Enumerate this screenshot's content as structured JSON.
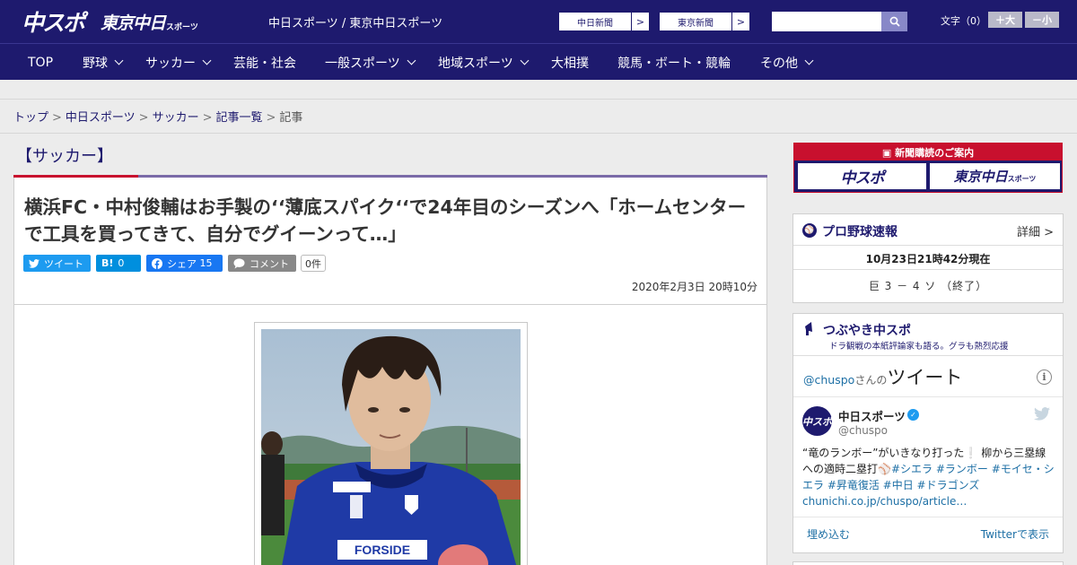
{
  "header": {
    "logo_chuspo": "中スポ",
    "logo_tokyo": "東京中日",
    "logo_tokyo_suffix": "スポーツ",
    "site_title": "中日スポーツ / 東京中日スポーツ",
    "paper_links": [
      {
        "label": "中日新聞"
      },
      {
        "label": "東京新聞"
      }
    ],
    "search": {
      "value": "",
      "placeholder": ""
    },
    "fontsize_label": "文字（0）",
    "fontsize_plus": "＋大",
    "fontsize_minus": "－小"
  },
  "nav": {
    "items": [
      {
        "label": "TOP",
        "dropdown": false
      },
      {
        "label": "野球",
        "dropdown": true
      },
      {
        "label": "サッカー",
        "dropdown": true
      },
      {
        "label": "芸能・社会",
        "dropdown": false
      },
      {
        "label": "一般スポーツ",
        "dropdown": true
      },
      {
        "label": "地域スポーツ",
        "dropdown": true
      },
      {
        "label": "大相撲",
        "dropdown": false
      },
      {
        "label": "競馬・ボート・競輪",
        "dropdown": false
      },
      {
        "label": "その他",
        "dropdown": true
      }
    ]
  },
  "breadcrumb": {
    "items": [
      "トップ",
      "中日スポーツ",
      "サッカー",
      "記事一覧"
    ],
    "current": "記事",
    "separator": ">"
  },
  "article": {
    "category": "【サッカー】",
    "headline": "横浜FC・中村俊輔はお手製の‘‘薄底スパイク‘‘で24年目のシーズンへ「ホームセンターで工具を買ってきて、自分でグイーンって…」",
    "share": {
      "tweet_label": "ツイート",
      "hatena_icon": "B!",
      "hatena_count": "0",
      "facebook_label": "シェア",
      "facebook_count": "15",
      "comment_label": "コメント",
      "comment_count": "0件"
    },
    "published": "2020年2月3日 20時10分",
    "photo_alt_icon": "player-photo"
  },
  "sidebar": {
    "subscribe": {
      "title": "新聞購読のご案内",
      "logo1": "中スポ",
      "logo2": "東京中日",
      "logo2_suffix": "スポーツ"
    },
    "baseball": {
      "title": "プロ野球速報",
      "more": "詳細 >",
      "time": "10月23日21時42分現在",
      "score": "巨 3 － 4 ソ （終了）"
    },
    "tsubuyaki": {
      "title": "つぶやき中スポ",
      "subtitle": "ドラ観戦の本紙評論家も語る。グラも熱烈応援",
      "handle_prefix": "@chuspo",
      "handle_suffix": "さんの",
      "tweets_label": "ツイート",
      "account_name": "中日スポーツ",
      "account_handle": "@chuspo",
      "avatar_text": "中スポ",
      "tweet_text_plain": "“竜のランボー”がいきなり打った❕ 柳から三塁線への適時二塁打",
      "tweet_tags": "#シエラ #ランボー #モイセ・シエラ #昇竜復活 #中日 #ドラゴンズ",
      "tweet_link": "chunichi.co.jp/chuspo/article…",
      "embed_label": "埋め込む",
      "view_label": "Twitterで表示"
    }
  },
  "colors": {
    "brand_navy": "#1e1a6e",
    "accent_red": "#c8102e",
    "twitter_blue": "#1d9bf0",
    "facebook_blue": "#1877f2",
    "hatena_blue": "#008fde"
  }
}
